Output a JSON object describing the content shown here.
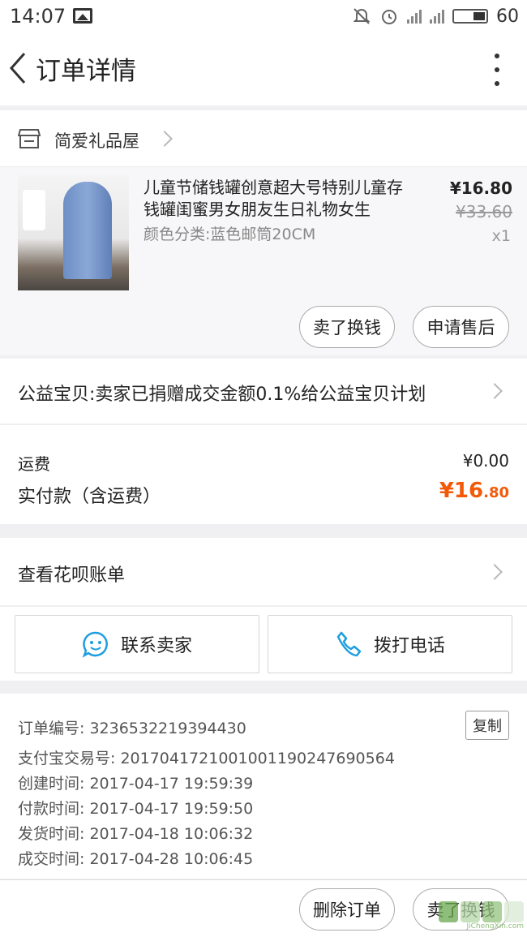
{
  "status_bar": {
    "time": "14:07",
    "battery": "60"
  },
  "header": {
    "title": "订单详情"
  },
  "shop": {
    "name": "简爱礼品屋"
  },
  "item": {
    "name": "儿童节储钱罐创意超大号特别儿童存钱罐闺蜜男女朋友生日礼物女生",
    "sku": "颜色分类:蓝色邮筒20CM",
    "price": "¥16.80",
    "original_price": "¥33.60",
    "quantity": "x1",
    "sell_button": "卖了换钱",
    "after_sale_button": "申请售后"
  },
  "charity": {
    "text": "公益宝贝:卖家已捐赠成交金额0.1%给公益宝贝计划"
  },
  "fees": {
    "shipping_label": "运费",
    "shipping_value": "¥0.00",
    "paid_label": "实付款（含运费）",
    "paid_currency": "¥",
    "paid_integer": "16",
    "paid_decimal": ".80"
  },
  "huabei": {
    "label": "查看花呗账单"
  },
  "contact": {
    "seller_label": "联系卖家",
    "phone_label": "拨打电话"
  },
  "order_info": {
    "rows": [
      "订单编号: 3236532219394430",
      "支付宝交易号: 2017041721001001190247690564",
      "创建时间: 2017-04-17 19:59:39",
      "付款时间: 2017-04-17 19:59:50",
      "发货时间: 2017-04-18 10:06:32",
      "成交时间: 2017-04-28 10:06:45"
    ],
    "copy_label": "复制"
  },
  "bottom_bar": {
    "delete_label": "删除订单",
    "sell_label": "卖了换钱"
  },
  "watermark": {
    "text": "JiChengXin.com"
  },
  "colors": {
    "accent_price": "#f25a0a",
    "contact_icon": "#1e9ee0"
  }
}
